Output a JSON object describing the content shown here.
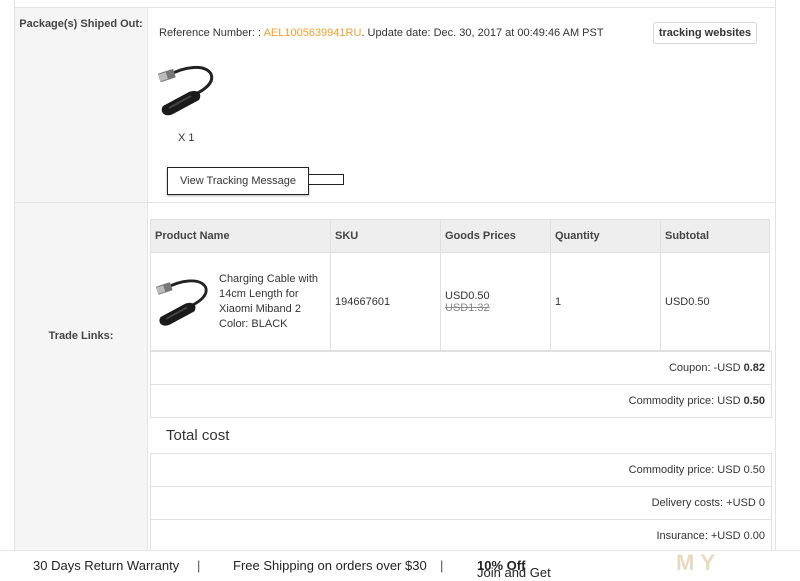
{
  "package": {
    "label": "Package(s) Shiped Out:",
    "reference_prefix": "Reference Number: : ",
    "reference_number": "AEL1005639941RU",
    "update_text": ". Update date: Dec. 30, 2017 at 00:49:46 AM PST",
    "tracking_websites": "tracking websites",
    "quantity": "X 1",
    "view_tracking": "View Tracking Message"
  },
  "trade": {
    "label": "Trade Links:",
    "headers": [
      "Product Name",
      "SKU",
      "Goods Prices",
      "Quantity",
      "Subtotal"
    ],
    "product": {
      "name": "Charging Cable with 14cm Length for Xiaomi Miband 2 Color: BLACK",
      "sku": "194667601",
      "price": "USD0.50",
      "old_price": "USD1.32",
      "quantity": "1",
      "subtotal": "USD0.50"
    },
    "coupon_label": "Coupon: -USD ",
    "coupon_value": "0.82",
    "commodity_label": "Commodity price: USD ",
    "commodity_value": "0.50"
  },
  "total": {
    "title": "Total cost",
    "commodity": "Commodity price: USD 0.50",
    "delivery": "Delivery costs: +USD 0",
    "insurance": "Insurance: +USD 0.00"
  },
  "footer": {
    "warranty": "30 Days Return Warranty",
    "sep1": "|",
    "shipping": "Free Shipping on orders over $30",
    "sep2": "|",
    "join_prefix": "Join and Get ",
    "join_bold": "10% Off"
  },
  "watermark": "MY"
}
